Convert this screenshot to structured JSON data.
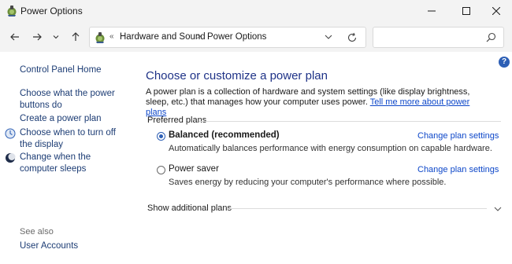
{
  "window": {
    "title": "Power Options",
    "controls": {
      "minimize_icon": "minimize-icon",
      "maximize_icon": "maximize-icon",
      "close_icon": "close-icon"
    }
  },
  "nav": {
    "back_icon": "arrow-left-icon",
    "forward_icon": "arrow-right-icon",
    "recent_icon": "chevron-down-icon",
    "up_icon": "arrow-up-icon"
  },
  "address": {
    "overflow": "«",
    "breadcrumbs": [
      "Hardware and Sound",
      "Power Options"
    ],
    "separator": ">"
  },
  "search": {
    "placeholder": "",
    "icon": "search-icon"
  },
  "sidebar": {
    "home": "Control Panel Home",
    "items": [
      {
        "label": "Choose what the power buttons do"
      },
      {
        "label": "Create a power plan"
      },
      {
        "label": "Choose when to turn off the display",
        "icon": "clock-icon"
      },
      {
        "label": "Change when the computer sleeps",
        "icon": "moon-icon"
      }
    ],
    "see_also": "See also",
    "see_also_items": [
      "User Accounts"
    ]
  },
  "main": {
    "heading": "Choose or customize a power plan",
    "description": "A power plan is a collection of hardware and system settings (like display brightness, sleep, etc.) that manages how your computer uses power.",
    "description_link": "Tell me more about power plans",
    "preferred_label": "Preferred plans",
    "plans": [
      {
        "name": "Balanced (recommended)",
        "description": "Automatically balances performance with energy consumption on capable hardware.",
        "change_label": "Change plan settings",
        "selected": true
      },
      {
        "name": "Power saver",
        "description": "Saves energy by reducing your computer's performance where possible.",
        "change_label": "Change plan settings",
        "selected": false
      }
    ],
    "additional_label": "Show additional plans"
  },
  "help": {
    "label": "?"
  },
  "colors": {
    "heading": "#1e3287",
    "link": "#0d47c9",
    "sidebar_link": "#1c3c74",
    "chrome": "#f3f3f3",
    "accent": "#2d5fb5"
  }
}
